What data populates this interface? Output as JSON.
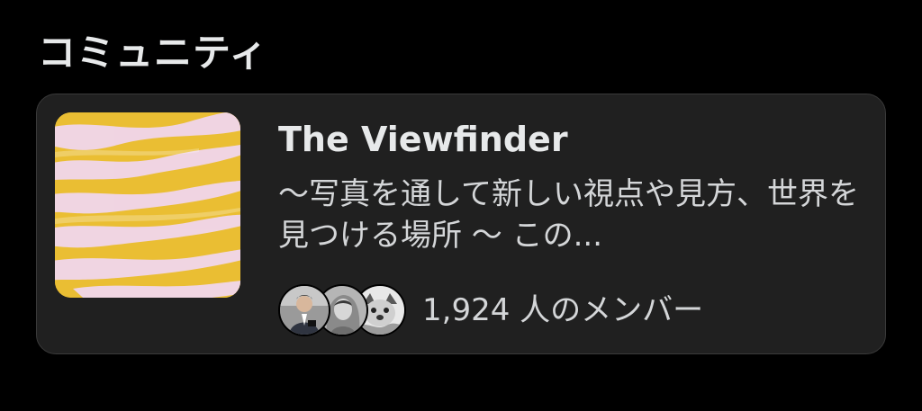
{
  "section": {
    "title": "コミュニティ"
  },
  "community": {
    "name": "The Viewfinder",
    "description": "〜写真を通して新しい視点や見方、世界を見つける場所 〜 この...",
    "member_count_label": "1,924 人のメンバー",
    "thumbnail": "yellow-pink-striped-image",
    "avatars": [
      "member-avatar-portrait",
      "member-avatar-sketch",
      "member-avatar-dog"
    ]
  },
  "colors": {
    "background": "#000000",
    "card_background": "#202020",
    "card_border": "#3a3a3a",
    "text_primary": "#e7e9ea",
    "text_secondary": "#d4d6d8",
    "thumb_yellow": "#e7b92d",
    "thumb_pink": "#f1d6ec"
  }
}
